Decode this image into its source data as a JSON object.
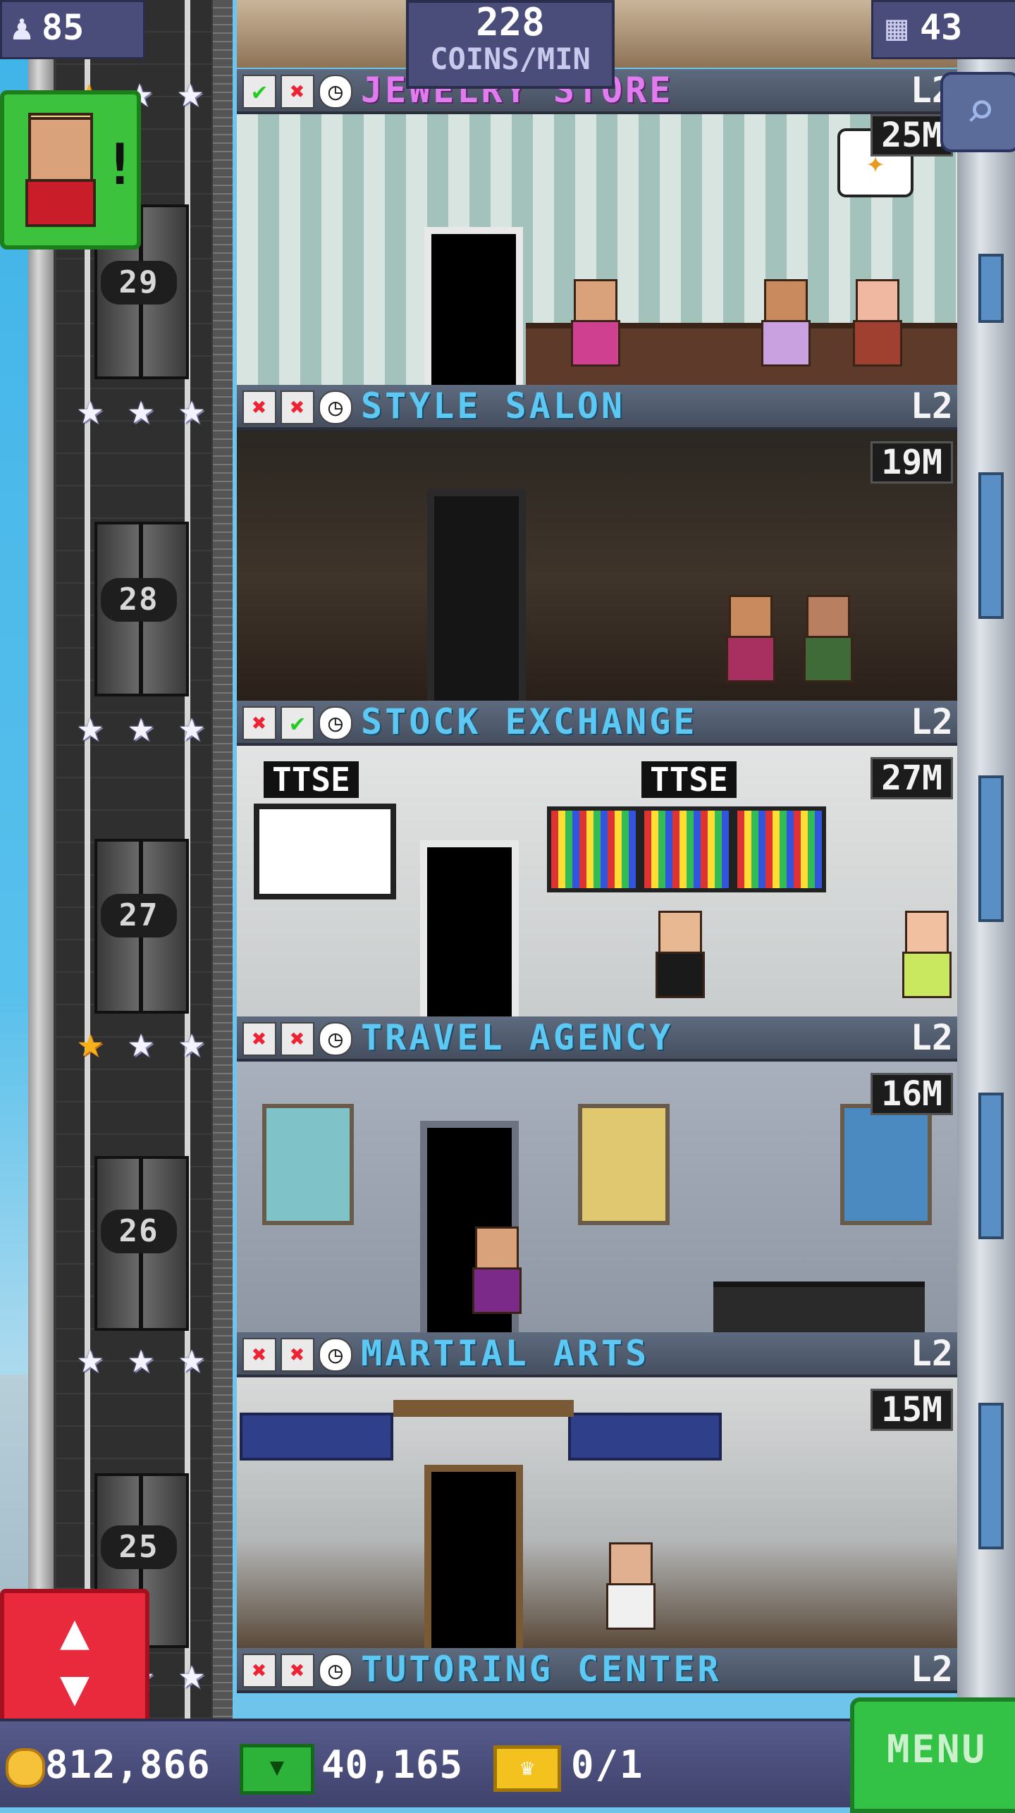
{
  "hud": {
    "population": "85",
    "population_icon": "person-icon",
    "coins_per_min": "228",
    "coins_per_min_unit": "COINS/MIN",
    "floor_count": "43",
    "floor_count_icon": "building-icon"
  },
  "floors": [
    {
      "name": "JEWELRY STORE",
      "level": "L2",
      "earnings": "25M",
      "floor_number": "29",
      "stars": [
        "gold",
        "silver",
        "silver"
      ],
      "checks": [
        "check",
        "cross",
        "clock"
      ],
      "name_color": "#e27bf0"
    },
    {
      "name": "STYLE SALON",
      "level": "L2",
      "earnings": "19M",
      "floor_number": "28",
      "stars": [
        "silver",
        "silver",
        "silver"
      ],
      "checks": [
        "cross",
        "cross",
        "clock"
      ]
    },
    {
      "name": "STOCK EXCHANGE",
      "level": "L2",
      "earnings": "27M",
      "floor_number": "27",
      "stars": [
        "silver",
        "silver",
        "silver"
      ],
      "checks": [
        "cross",
        "check",
        "clock"
      ],
      "signs": [
        "TTSE",
        "TTSE"
      ]
    },
    {
      "name": "TRAVEL AGENCY",
      "level": "L2",
      "earnings": "16M",
      "floor_number": "26",
      "stars": [
        "gold",
        "silver",
        "silver"
      ],
      "checks": [
        "cross",
        "cross",
        "clock"
      ]
    },
    {
      "name": "MARTIAL ARTS",
      "level": "L2",
      "earnings": "15M",
      "floor_number": "25",
      "stars": [
        "silver",
        "silver",
        "silver"
      ],
      "checks": [
        "cross",
        "cross",
        "clock"
      ]
    },
    {
      "name": "TUTORING CENTER",
      "level": "L2",
      "stars": [
        "silver",
        "silver"
      ],
      "checks": [
        "cross",
        "cross",
        "clock"
      ]
    }
  ],
  "buttons": {
    "zoom_icon": "magnifier-icon",
    "visitor_alert": "!",
    "elevator_icon": "up-down-arrows-icon",
    "menu_label": "MENU"
  },
  "currency": {
    "coins": "812,866",
    "coins_icon": "coin-icon",
    "bux": "40,165",
    "bux_icon": "tower-bux-icon",
    "tickets": "0/1",
    "tickets_icon": "golden-ticket-icon"
  }
}
